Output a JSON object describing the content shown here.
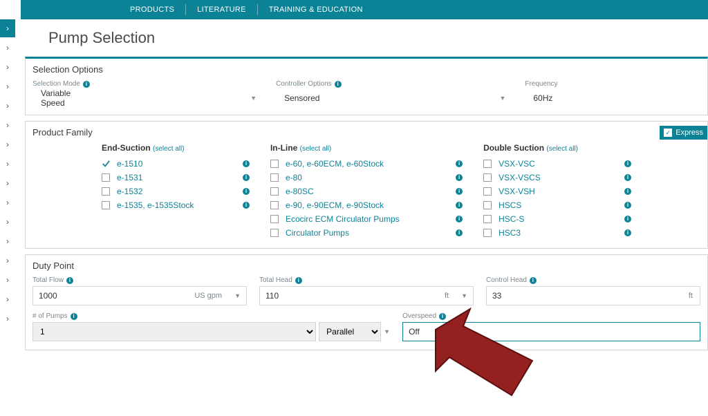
{
  "nav": {
    "products": "PRODUCTS",
    "literature": "LITERATURE",
    "training": "TRAINING & EDUCATION"
  },
  "page_title": "Pump Selection",
  "selection_options": {
    "header": "Selection Options",
    "mode_label": "Selection Mode",
    "mode_value": "Variable Speed",
    "controller_label": "Controller Options",
    "controller_value": "Sensored",
    "frequency_label": "Frequency",
    "frequency_value": "60Hz"
  },
  "product_family": {
    "header": "Product Family",
    "express_label": "Express",
    "select_all": "(select all)",
    "end_suction": {
      "title": "End-Suction",
      "items": [
        {
          "label": "e-1510",
          "checked": true
        },
        {
          "label": "e-1531",
          "checked": false
        },
        {
          "label": "e-1532",
          "checked": false
        },
        {
          "label": "e-1535, e-1535Stock",
          "checked": false
        }
      ]
    },
    "in_line": {
      "title": "In-Line",
      "items": [
        {
          "label": "e-60, e-60ECM, e-60Stock",
          "checked": false
        },
        {
          "label": "e-80",
          "checked": false
        },
        {
          "label": "e-80SC",
          "checked": false
        },
        {
          "label": "e-90, e-90ECM, e-90Stock",
          "checked": false
        },
        {
          "label": "Ecocirc ECM Circulator Pumps",
          "checked": false
        },
        {
          "label": "Circulator Pumps",
          "checked": false
        }
      ]
    },
    "double_suction": {
      "title": "Double Suction",
      "items": [
        {
          "label": "VSX-VSC",
          "checked": false
        },
        {
          "label": "VSX-VSCS",
          "checked": false
        },
        {
          "label": "VSX-VSH",
          "checked": false
        },
        {
          "label": "HSCS",
          "checked": false
        },
        {
          "label": "HSC-S",
          "checked": false
        },
        {
          "label": "HSC3",
          "checked": false
        }
      ]
    }
  },
  "duty_point": {
    "header": "Duty Point",
    "total_flow_label": "Total Flow",
    "total_flow_value": "1000",
    "total_flow_unit": "US gpm",
    "total_head_label": "Total Head",
    "total_head_value": "110",
    "total_head_unit": "ft",
    "control_head_label": "Control Head",
    "control_head_value": "33",
    "control_head_unit": "ft",
    "num_pumps_label": "# of Pumps",
    "num_pumps_value": "1",
    "arrangement_value": "Parallel",
    "overspeed_label": "Overspeed",
    "overspeed_value": "Off"
  },
  "colors": {
    "accent": "#0c8296",
    "arrow": "#942020"
  }
}
